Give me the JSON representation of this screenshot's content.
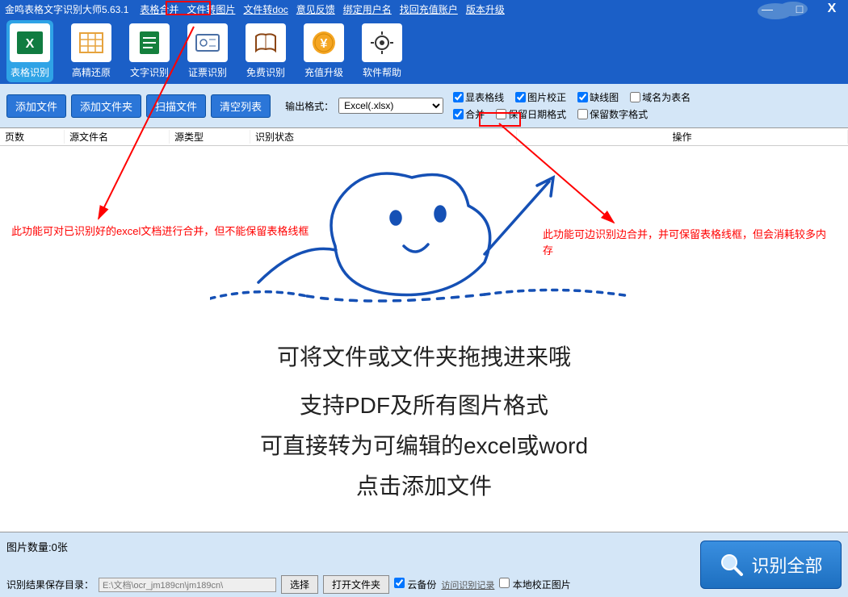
{
  "title": "金鸣表格文字识别大师5.63.1",
  "menus": [
    "表格合并",
    "文件转图片",
    "文件转doc",
    "意见反馈",
    "绑定用户名",
    "找回充值账户",
    "版本升级"
  ],
  "winctrl": {
    "min": "—",
    "max": "□",
    "close": "X"
  },
  "ribbon": [
    {
      "name": "excel",
      "label": "表格识别",
      "active": true
    },
    {
      "name": "restore",
      "label": "高精还原"
    },
    {
      "name": "text",
      "label": "文字识别"
    },
    {
      "name": "cert",
      "label": "证票识别"
    },
    {
      "name": "free",
      "label": "免费识别"
    },
    {
      "name": "pay",
      "label": "充值升级"
    },
    {
      "name": "help",
      "label": "软件帮助"
    }
  ],
  "toolbar": {
    "add_file": "添加文件",
    "add_folder": "添加文件夹",
    "scan": "扫描文件",
    "clear": "清空列表",
    "fmt_label": "输出格式：",
    "fmt_value": "Excel(.xlsx)"
  },
  "checks": {
    "show_grid": "显表格线",
    "img_correct": "图片校正",
    "fill_line": "缺线图",
    "domain_sheet": "域名为表名",
    "merge": "合并",
    "keep_date": "保留日期格式",
    "keep_num": "保留数字格式"
  },
  "cols": {
    "pages": "页数",
    "src": "源文件名",
    "type": "源类型",
    "status": "识别状态",
    "op": "操作"
  },
  "annot": {
    "left": "此功能可对已识别好的excel文档进行合并，但不能保留表格线框",
    "right": "此功能可边识别边合并，并可保留表格线框，但会消耗较多内存"
  },
  "big": {
    "l1": "可将文件或文件夹拖拽进来哦",
    "l2": "支持PDF及所有图片格式",
    "l3": "可直接转为可编辑的excel或word",
    "l4": "点击添加文件"
  },
  "footer": {
    "count": "图片数量:0张",
    "save_label": "识别结果保存目录：",
    "save_path": "E:\\文档\\ocr_jm189cn\\jm189cn\\",
    "select": "选择",
    "open": "打开文件夹",
    "cloud": "云备份",
    "viewlog": "访问识别记录",
    "local_correct": "本地校正图片",
    "recognize": "识别全部"
  }
}
